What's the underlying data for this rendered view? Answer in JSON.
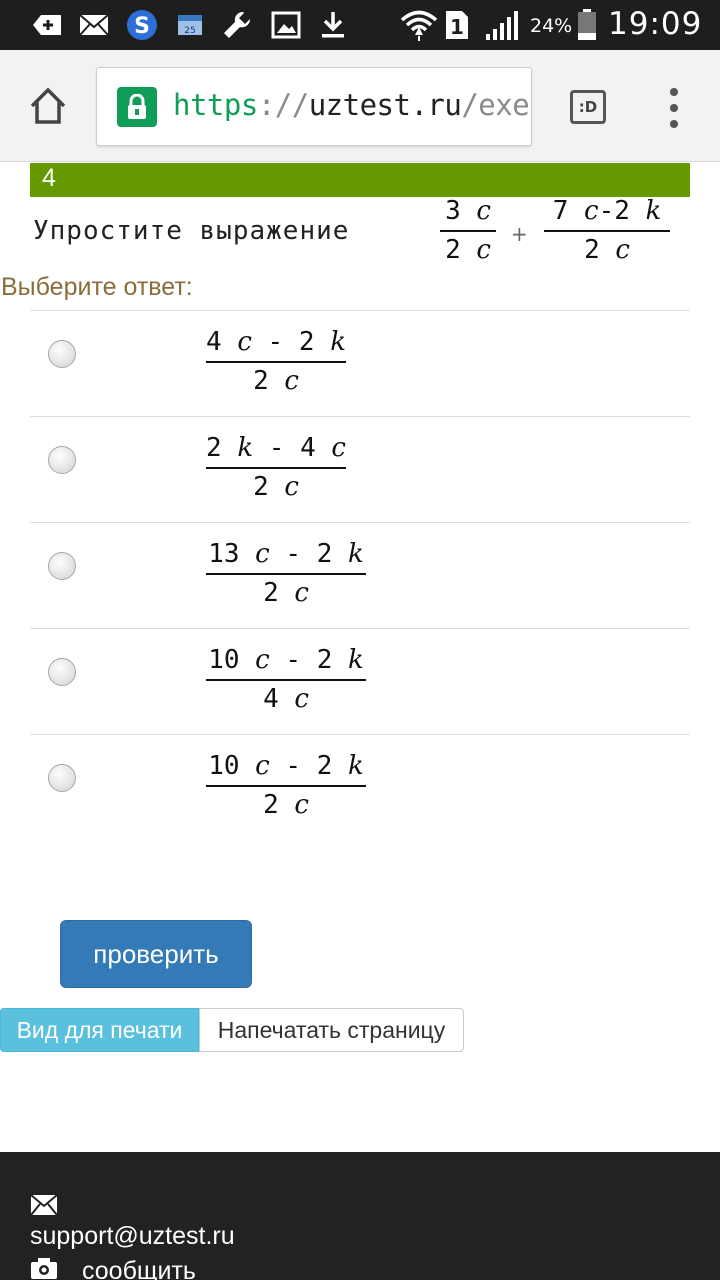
{
  "status_bar": {
    "time": "19:09",
    "battery_percent": "24%",
    "sim_slot": "1",
    "icons": [
      "add-notification-icon",
      "mail-icon",
      "skype-icon",
      "calendar-icon",
      "wrench-icon",
      "image-icon",
      "download-icon",
      "wifi-icon",
      "sim-icon",
      "signal-icon",
      "battery-icon"
    ]
  },
  "browser": {
    "url": {
      "scheme": "https",
      "separator": "://",
      "host": "uztest.ru",
      "path": "/exer"
    },
    "tabs_label": ":D"
  },
  "question": {
    "number": "4",
    "prompt": "Упростите выражение",
    "operator": "+",
    "term1": {
      "numerator": [
        "3 ",
        "c"
      ],
      "denominator": [
        "2 ",
        "c"
      ]
    },
    "term2": {
      "numerator": [
        "7 ",
        "c",
        "-2 ",
        "k"
      ],
      "denominator": [
        "2 ",
        "c"
      ]
    }
  },
  "answer_label": "Выберите ответ:",
  "options": [
    {
      "numerator": [
        "4 ",
        "c",
        " - 2 ",
        "k"
      ],
      "denominator": [
        "2 ",
        "c"
      ]
    },
    {
      "numerator": [
        "2 ",
        "k",
        " - 4 ",
        "c"
      ],
      "denominator": [
        "2 ",
        "c"
      ]
    },
    {
      "numerator": [
        "13 ",
        "c",
        " - 2 ",
        "k"
      ],
      "denominator": [
        "2 ",
        "c"
      ]
    },
    {
      "numerator": [
        "10 ",
        "c",
        " - 2 ",
        "k"
      ],
      "denominator": [
        "4 ",
        "c"
      ]
    },
    {
      "numerator": [
        "10 ",
        "c",
        " - 2 ",
        "k"
      ],
      "denominator": [
        "2 ",
        "c"
      ]
    }
  ],
  "buttons": {
    "check": "проверить",
    "print_view": "Вид для печати",
    "print_page": "Напечатать страницу"
  },
  "footer": {
    "email": "support@uztest.ru",
    "report": "сообщить"
  },
  "colors": {
    "question_header": "#669900",
    "answer_label": "#8a6d3b",
    "check_button": "#337ab7",
    "print_view_button": "#5bc0de",
    "footer": "#222222",
    "secure_green": "#0f9d58"
  }
}
